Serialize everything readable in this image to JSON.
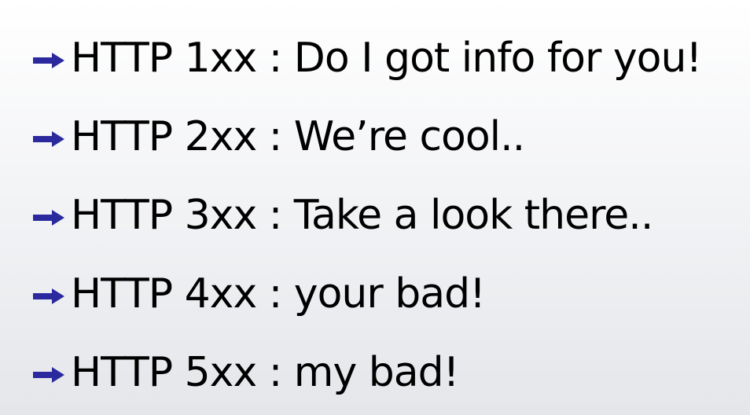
{
  "colors": {
    "arrow": "#2a2a9e",
    "text": "#000000"
  },
  "bullets": [
    {
      "icon": "arrow-right-icon",
      "text": "HTTP 1xx : Do I got info for you!"
    },
    {
      "icon": "arrow-right-icon",
      "text": "HTTP 2xx : We’re cool.."
    },
    {
      "icon": "arrow-right-icon",
      "text": "HTTP 3xx : Take a look there.."
    },
    {
      "icon": "arrow-right-icon",
      "text": "HTTP 4xx : your bad!"
    },
    {
      "icon": "arrow-right-icon",
      "text": "HTTP 5xx : my bad!"
    }
  ]
}
